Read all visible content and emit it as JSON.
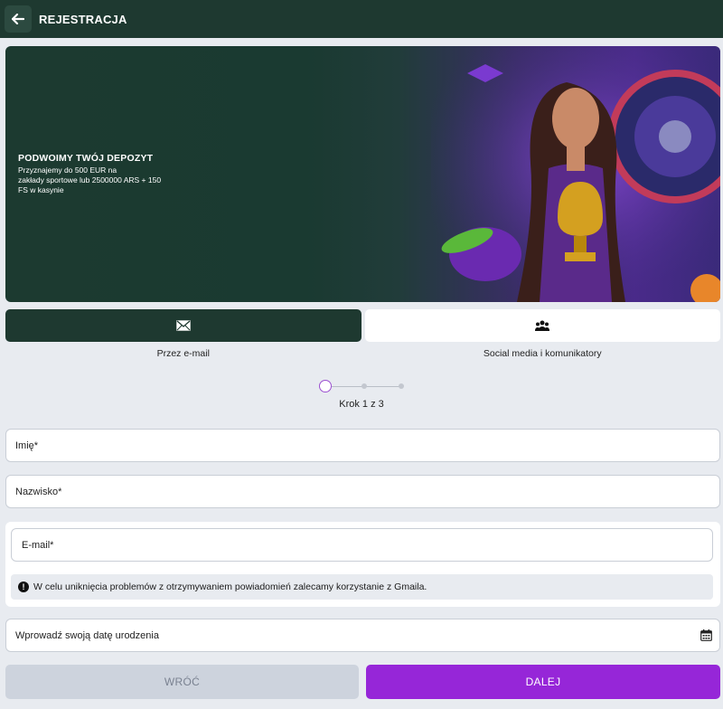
{
  "header": {
    "title": "REJESTRACJA",
    "back_icon": "arrow-left-icon"
  },
  "banner": {
    "title": "PODWOIMY TWÓJ DEPOZYT",
    "desc_line1": "Przyznajemy do 500 EUR na",
    "desc_line2": "zakłady sportowe lub 2500000 ARS + 150",
    "desc_line3": "FS w kasynie"
  },
  "tabs": [
    {
      "label": "Przez e-mail",
      "icon": "envelope-icon",
      "active": true
    },
    {
      "label": "Social media i komunikatory",
      "icon": "users-icon",
      "active": false
    }
  ],
  "stepper": {
    "text": "Krok 1 z 3",
    "current": 1,
    "total": 3
  },
  "form": {
    "first_name_placeholder": "Imię*",
    "last_name_placeholder": "Nazwisko*",
    "email_placeholder": "E-mail*",
    "email_hint": "W celu uniknięcia problemów z otrzymywaniem powiadomień zalecamy korzystanie z Gmaila.",
    "birthdate_placeholder": "Wprowadź swoją datę urodzenia"
  },
  "buttons": {
    "back": "WRÓĆ",
    "next": "DALEJ"
  },
  "colors": {
    "header_bg": "#1e3930",
    "accent": "#9626d8",
    "page_bg": "#e8ebf0"
  }
}
